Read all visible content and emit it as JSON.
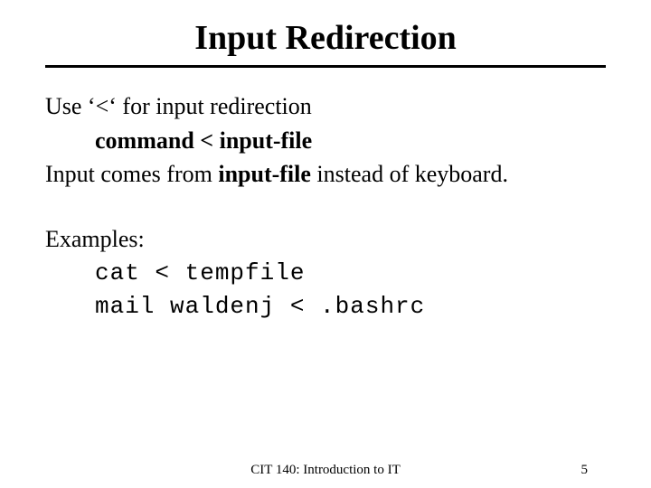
{
  "title": "Input Redirection",
  "line1_a": "Use ‘<‘ for input redirection",
  "syntax": "command < input-file",
  "line2_a": "Input comes from ",
  "line2_b": "input-file",
  "line2_c": " instead of keyboard.",
  "examples_label": "Examples:",
  "example1": "cat < tempfile",
  "example2": "mail waldenj < .bashrc",
  "footer_course": "CIT 140: Introduction to IT",
  "footer_page": "5"
}
